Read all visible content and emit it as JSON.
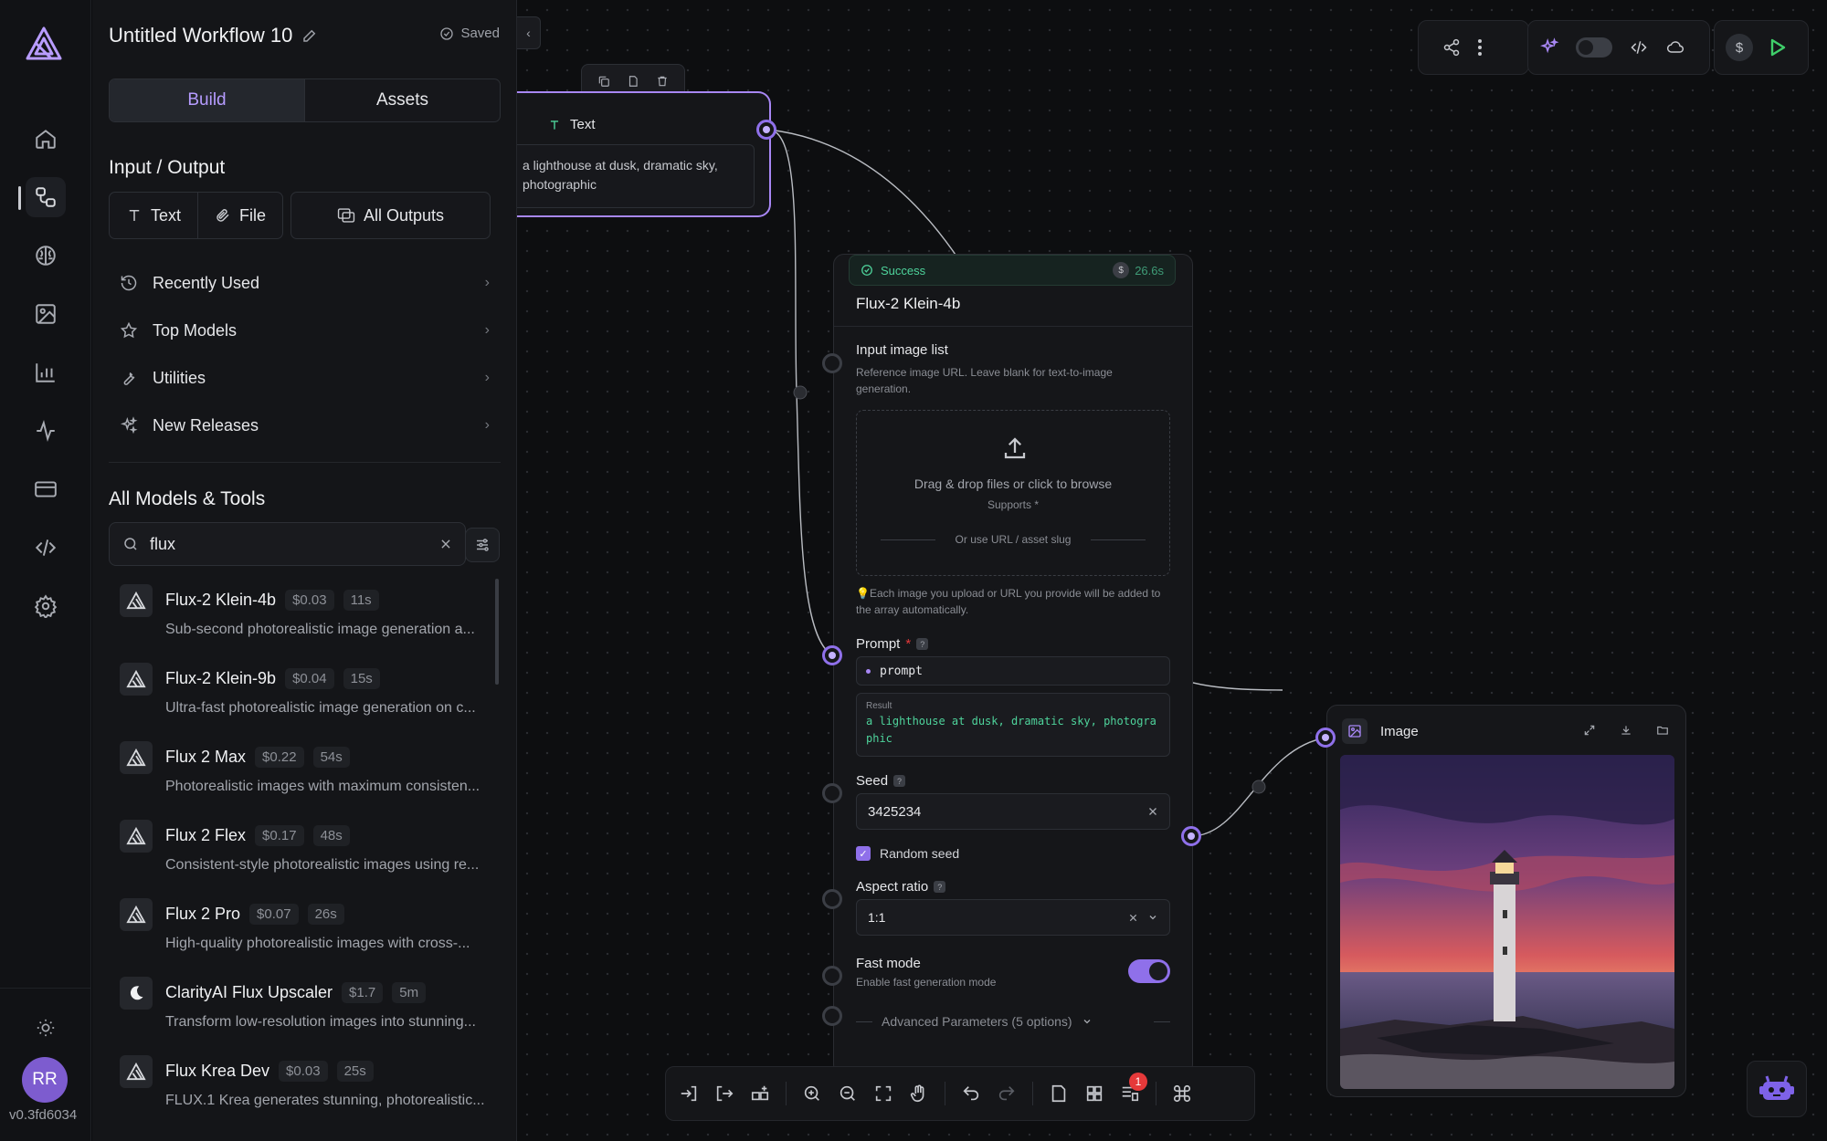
{
  "workflow": {
    "title": "Untitled Workflow 10",
    "saved_label": "Saved"
  },
  "tabs": {
    "build": "Build",
    "assets": "Assets"
  },
  "input_output": {
    "heading": "Input / Output",
    "text_btn": "Text",
    "file_btn": "File",
    "all_outputs_btn": "All Outputs"
  },
  "categories": [
    {
      "label": "Recently Used",
      "icon": "history-icon"
    },
    {
      "label": "Top Models",
      "icon": "star-icon"
    },
    {
      "label": "Utilities",
      "icon": "wrench-icon"
    },
    {
      "label": "New Releases",
      "icon": "sparkles-icon"
    }
  ],
  "models_section": {
    "heading": "All Models & Tools"
  },
  "search": {
    "value": "flux"
  },
  "models": [
    {
      "name": "Flux-2 Klein-4b",
      "price": "$0.03",
      "time": "11s",
      "desc": "Sub-second photorealistic image generation a..."
    },
    {
      "name": "Flux-2 Klein-9b",
      "price": "$0.04",
      "time": "15s",
      "desc": "Ultra-fast photorealistic image generation on c..."
    },
    {
      "name": "Flux 2 Max",
      "price": "$0.22",
      "time": "54s",
      "desc": "Photorealistic images with maximum consisten..."
    },
    {
      "name": "Flux 2 Flex",
      "price": "$0.17",
      "time": "48s",
      "desc": "Consistent-style photorealistic images using re..."
    },
    {
      "name": "Flux 2 Pro",
      "price": "$0.07",
      "time": "26s",
      "desc": "High-quality photorealistic images with cross-..."
    },
    {
      "name": "ClarityAI Flux Upscaler",
      "price": "$1.7",
      "time": "5m",
      "desc": "Transform low-resolution images into stunning..."
    },
    {
      "name": "Flux Krea Dev",
      "price": "$0.03",
      "time": "25s",
      "desc": "FLUX.1 Krea generates stunning, photorealistic..."
    }
  ],
  "user": {
    "initials": "RR",
    "version": "v0.3fd6034"
  },
  "text_node": {
    "title": "Text",
    "content": "a lighthouse at dusk, dramatic sky, photographic"
  },
  "flux_node": {
    "status": "Success",
    "status_time": "26.6s",
    "title": "Flux-2 Klein-4b",
    "input_image_label": "Input image list",
    "input_image_desc": "Reference image URL. Leave blank for text-to-image generation.",
    "drop_text": "Drag & drop files or click to browse",
    "supports_text": "Supports *",
    "url_text": "Or use URL / asset slug",
    "hint_text": "💡Each image you upload or URL you provide will be added to the array automatically.",
    "prompt_label": "Prompt",
    "prompt_required": "*",
    "prompt_input": "prompt",
    "result_label": "Result",
    "result_text": "a lighthouse at dusk, dramatic sky, photographic",
    "seed_label": "Seed",
    "seed_value": "3425234",
    "random_seed_label": "Random seed",
    "random_seed_checked": true,
    "aspect_label": "Aspect ratio",
    "aspect_value": "1:1",
    "fast_mode_label": "Fast mode",
    "fast_mode_desc": "Enable fast generation mode",
    "fast_mode_on": true,
    "advanced_label": "Advanced Parameters (5 options)"
  },
  "image_node": {
    "title": "Image"
  },
  "bottom_bar": {
    "badge_count": "1"
  },
  "colors": {
    "accent": "#8f70ea",
    "success": "#4ed39b",
    "run": "#3fcf6a"
  }
}
